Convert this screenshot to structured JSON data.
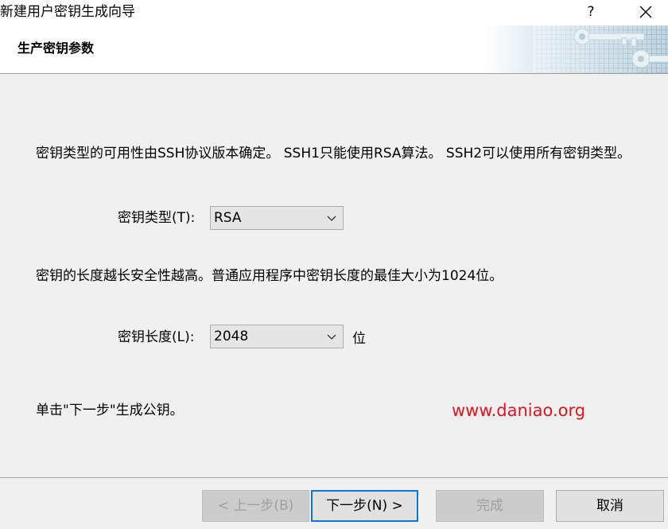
{
  "window": {
    "title": "新建用户密钥生成向导",
    "help_label": "?",
    "close_icon": "close-icon"
  },
  "header": {
    "title": "生产密钥参数",
    "banner_icon": "keys-banner-icon"
  },
  "body": {
    "intro": "密钥类型的可用性由SSH协议版本确定。 SSH1只能使用RSA算法。 SSH2可以使用所有密钥类型。",
    "key_type": {
      "label": "密钥类型(T):",
      "value": "RSA"
    },
    "length_hint": "密钥的长度越长安全性越高。普通应用程序中密钥长度的最佳大小为1024位。",
    "key_length": {
      "label": "密钥长度(L):",
      "value": "2048",
      "unit": "位"
    },
    "next_hint": "单击\"下一步\"生成公钥。",
    "watermark": "www.daniao.org"
  },
  "footer": {
    "back_label": "< 上一步(B)",
    "next_label": "下一步(N) >",
    "finish_label": "完成",
    "cancel_label": "取消"
  },
  "colors": {
    "accent": "#0078d7",
    "watermark": "#e0141e",
    "background": "#f0f0f0"
  }
}
